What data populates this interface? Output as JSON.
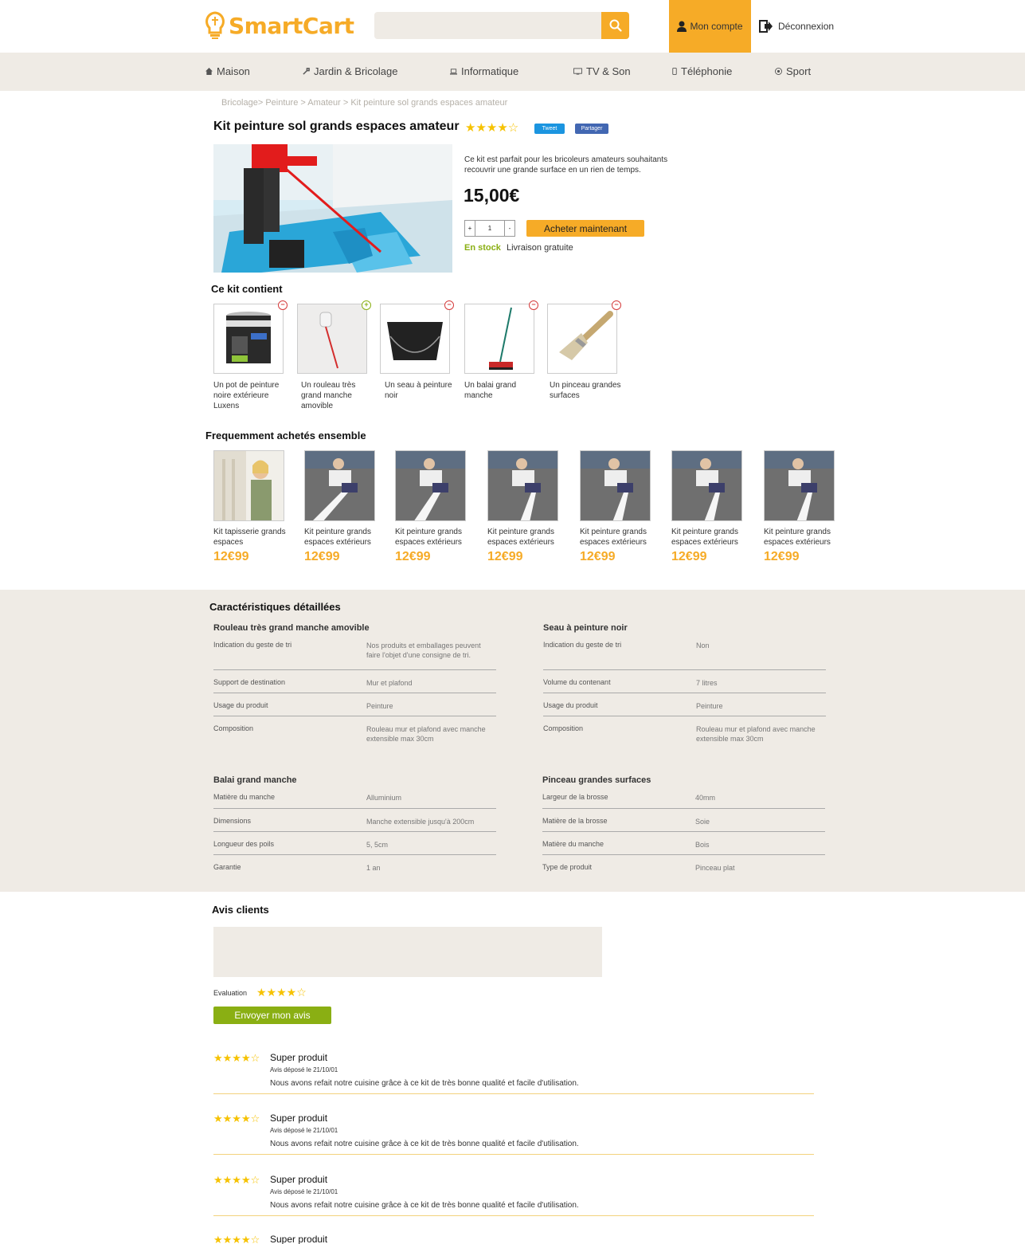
{
  "header": {
    "logo_text": "SmartCart",
    "account_label": "Mon compte",
    "logout_label": "Déconnexion",
    "search_placeholder": "",
    "brand_color": "#f6ab27"
  },
  "nav": {
    "items": [
      {
        "label": "Maison",
        "icon": "home-icon"
      },
      {
        "label": "Jardin & Bricolage",
        "icon": "wrench-icon"
      },
      {
        "label": "Informatique",
        "icon": "laptop-icon"
      },
      {
        "label": "TV & Son",
        "icon": "tv-icon"
      },
      {
        "label": "Téléphonie",
        "icon": "phone-icon"
      },
      {
        "label": "Sport",
        "icon": "soccer-ball-icon"
      }
    ]
  },
  "breadcrumb": "Bricolage> Peinture > Amateur > Kit peinture sol grands espaces amateur",
  "product": {
    "title": "Kit peinture sol grands espaces amateur",
    "rating": 4,
    "tweet_label": "Tweet",
    "share_label": "Partager",
    "description": "Ce kit est parfait pour les bricoleurs amateurs souhaitants recouvrir une grande surface en un rien de temps.",
    "price": "15,00€",
    "quantity": "1",
    "qty_plus": "+",
    "qty_minus": "-",
    "buy_label": "Acheter maintenant",
    "stock_label": "En stock",
    "delivery_label": "Livraison gratuite"
  },
  "kit": {
    "title": "Ce kit contient",
    "items": [
      {
        "label": "Un pot de peinture noire extérieure Luxens",
        "badge": "remove"
      },
      {
        "label": "Un rouleau très grand manche amovible",
        "badge": "add"
      },
      {
        "label": "Un seau à peinture noir",
        "badge": "remove"
      },
      {
        "label": "Un balai grand manche",
        "badge": "remove"
      },
      {
        "label": "Un pinceau grandes surfaces",
        "badge": "remove"
      }
    ]
  },
  "frequently_bought": {
    "title": "Frequemment achetés ensemble",
    "items": [
      {
        "label": "Kit tapisserie grands espaces",
        "price": "12€99"
      },
      {
        "label": "Kit peinture grands espaces extérieurs",
        "price": "12€99"
      },
      {
        "label": "Kit peinture grands espaces extérieurs",
        "price": "12€99"
      },
      {
        "label": "Kit peinture grands espaces extérieurs",
        "price": "12€99"
      },
      {
        "label": "Kit peinture grands espaces extérieurs",
        "price": "12€99"
      },
      {
        "label": "Kit peinture grands espaces extérieurs",
        "price": "12€99"
      },
      {
        "label": "Kit peinture grands espaces extérieurs",
        "price": "12€99"
      }
    ]
  },
  "specs": {
    "title": "Caractéristiques détaillées",
    "blocks": [
      {
        "title": "Rouleau très grand manche amovible",
        "rows": [
          {
            "key": "Indication du geste de tri",
            "value": "Nos produits et emballages peuvent faire l'objet d'une consigne de tri."
          },
          {
            "key": "Support de destination",
            "value": "Mur et plafond"
          },
          {
            "key": "Usage du produit",
            "value": "Peinture"
          },
          {
            "key": "Composition",
            "value": "Rouleau mur et plafond avec manche extensible max 30cm"
          }
        ]
      },
      {
        "title": "Seau à peinture noir",
        "rows": [
          {
            "key": "Indication du geste de tri",
            "value": "Non"
          },
          {
            "key": "Volume du contenant",
            "value": "7 litres"
          },
          {
            "key": "Usage du produit",
            "value": "Peinture"
          },
          {
            "key": "Composition",
            "value": "Rouleau mur et plafond avec manche extensible max 30cm"
          }
        ]
      },
      {
        "title": "Balai grand manche",
        "rows": [
          {
            "key": "Matière du manche",
            "value": "Alluminium"
          },
          {
            "key": "Dimensions",
            "value": "Manche extensible jusqu'à 200cm"
          },
          {
            "key": "Longueur des poils",
            "value": "5, 5cm"
          },
          {
            "key": "Garantie",
            "value": "1 an"
          }
        ]
      },
      {
        "title": "Pinceau grandes surfaces",
        "rows": [
          {
            "key": "Largeur de la brosse",
            "value": "40mm"
          },
          {
            "key": "Matière de la brosse",
            "value": "Soie"
          },
          {
            "key": "Matière du manche",
            "value": "Bois"
          },
          {
            "key": "Type de produit",
            "value": "Pinceau plat"
          }
        ]
      }
    ]
  },
  "reviews": {
    "title": "Avis clients",
    "evaluation_label": "Evaluation",
    "evaluation_rating": 4,
    "send_label": "Envoyer mon avis",
    "items": [
      {
        "rating": 4,
        "title": "Super produit",
        "date": "Avis déposé le 21/10/01",
        "text": "Nous avons refait notre cuisine grâce à ce kit de très bonne qualité et facile d'utilisation."
      },
      {
        "rating": 4,
        "title": "Super produit",
        "date": "Avis déposé le 21/10/01",
        "text": "Nous avons refait notre cuisine grâce à ce kit de très bonne qualité et facile d'utilisation."
      },
      {
        "rating": 4,
        "title": "Super produit",
        "date": "Avis déposé le 21/10/01",
        "text": "Nous avons refait notre cuisine grâce à ce kit de très bonne qualité et facile d'utilisation."
      },
      {
        "rating": 4,
        "title": "Super produit",
        "date": "",
        "text": ""
      }
    ]
  }
}
